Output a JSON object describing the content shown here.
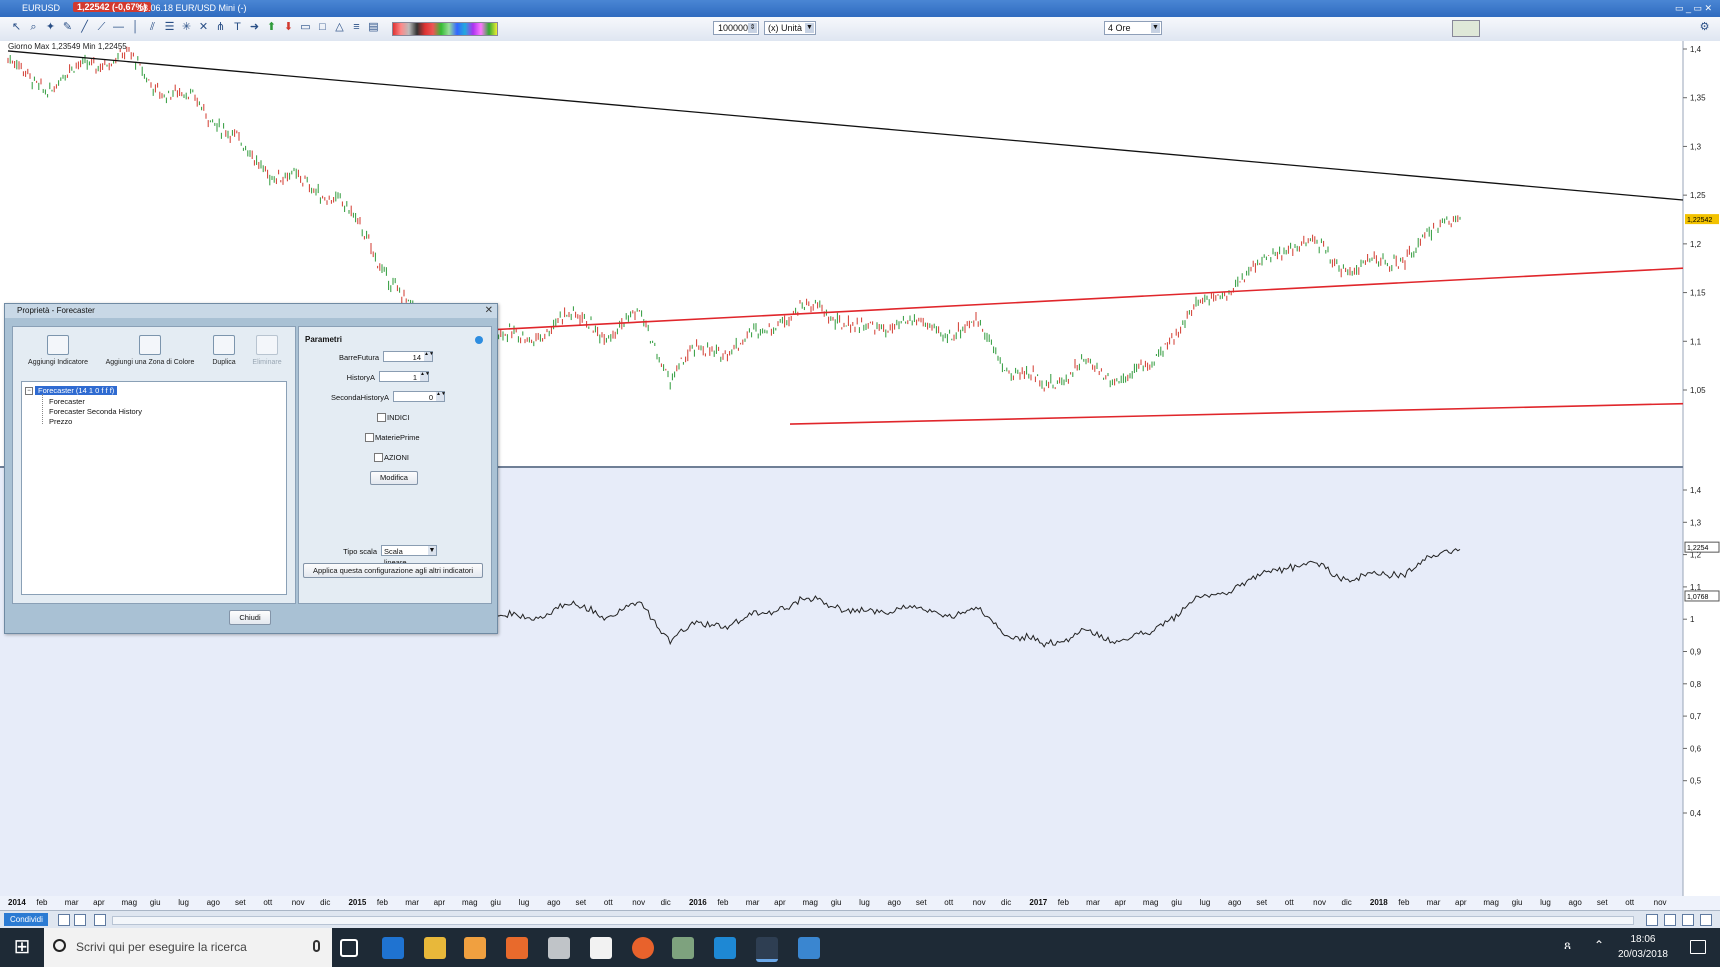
{
  "window": {
    "symbol": "EURUSD",
    "price_badge": "1,22542 (-0,67%)",
    "contract_info": "18.06.18 EUR/USD Mini (-)",
    "controls": "▭ _ ▭ ✕"
  },
  "toolbar": {
    "quantity": "100000",
    "unit": "(x) Unità",
    "timeframe": "4 Ore"
  },
  "chart": {
    "info_label": "Giorno Max 1,23549 Min 1,22455",
    "price_axis_top": [
      "1,4",
      "1,35",
      "1,3",
      "1,25",
      "1,2",
      "1,15",
      "1,1",
      "1,05"
    ],
    "price_axis_bottom": [
      "1,4",
      "1,3",
      "1,2",
      "1,1",
      "1",
      "0,9",
      "0,8",
      "0,7",
      "0,6",
      "0,5",
      "0,4"
    ],
    "last_price_tag": "1,22542",
    "lower_price_tag": "1,2254",
    "lower_price_tag2": "1,0768",
    "colors": {
      "up_candle": "#2e9a3a",
      "down_candle": "#d23a2f",
      "trendline": "#111111",
      "channel": "#e0262b",
      "forecaster_line": "#222222"
    }
  },
  "time_axis": [
    {
      "label": "2014",
      "year": true
    },
    {
      "label": "feb"
    },
    {
      "label": "mar"
    },
    {
      "label": "apr"
    },
    {
      "label": "mag"
    },
    {
      "label": "giu"
    },
    {
      "label": "lug"
    },
    {
      "label": "ago"
    },
    {
      "label": "set"
    },
    {
      "label": "ott"
    },
    {
      "label": "nov"
    },
    {
      "label": "dic"
    },
    {
      "label": "2015",
      "year": true
    },
    {
      "label": "feb"
    },
    {
      "label": "mar"
    },
    {
      "label": "apr"
    },
    {
      "label": "mag"
    },
    {
      "label": "giu"
    },
    {
      "label": "lug"
    },
    {
      "label": "ago"
    },
    {
      "label": "set"
    },
    {
      "label": "ott"
    },
    {
      "label": "nov"
    },
    {
      "label": "dic"
    },
    {
      "label": "2016",
      "year": true
    },
    {
      "label": "feb"
    },
    {
      "label": "mar"
    },
    {
      "label": "apr"
    },
    {
      "label": "mag"
    },
    {
      "label": "giu"
    },
    {
      "label": "lug"
    },
    {
      "label": "ago"
    },
    {
      "label": "set"
    },
    {
      "label": "ott"
    },
    {
      "label": "nov"
    },
    {
      "label": "dic"
    },
    {
      "label": "2017",
      "year": true
    },
    {
      "label": "feb"
    },
    {
      "label": "mar"
    },
    {
      "label": "apr"
    },
    {
      "label": "mag"
    },
    {
      "label": "giu"
    },
    {
      "label": "lug"
    },
    {
      "label": "ago"
    },
    {
      "label": "set"
    },
    {
      "label": "ott"
    },
    {
      "label": "nov"
    },
    {
      "label": "dic"
    },
    {
      "label": "2018",
      "year": true
    },
    {
      "label": "feb"
    },
    {
      "label": "mar"
    },
    {
      "label": "apr"
    },
    {
      "label": "mag"
    },
    {
      "label": "giu"
    },
    {
      "label": "lug"
    },
    {
      "label": "ago"
    },
    {
      "label": "set"
    },
    {
      "label": "ott"
    },
    {
      "label": "nov"
    }
  ],
  "dialog": {
    "title": "Proprietà - Forecaster",
    "buttons": {
      "add_indicator": "Aggiungi Indicatore",
      "add_color_zone": "Aggiungi una Zona di Colore",
      "duplicate": "Duplica",
      "delete": "Eliminare"
    },
    "tree": {
      "root": "Forecaster (14 1 0 f f f)",
      "items": [
        "Forecaster",
        "Forecaster Seconda History",
        "Prezzo"
      ]
    },
    "params": {
      "title": "Parametri",
      "barre_futura_label": "BarreFutura",
      "barre_futura_value": "14",
      "history_a_label": "HistoryA",
      "history_a_value": "1",
      "seconda_history_label": "SecondaHistoryA",
      "seconda_history_value": "0",
      "indici": "INDICI",
      "materie_prime": "MateriePrime",
      "azioni": "AZIONI",
      "modifica": "Modifica",
      "tipo_scala_label": "Tipo scala",
      "tipo_scala_value": "Scala lineare",
      "apply_all": "Applica questa configurazione agli altri indicatori"
    },
    "close_button": "Chiudi"
  },
  "statusbar": {
    "share": "Condividi"
  },
  "taskbar": {
    "search_placeholder": "Scrivi qui per eseguire la ricerca",
    "time": "18:06",
    "date": "20/03/2018"
  }
}
